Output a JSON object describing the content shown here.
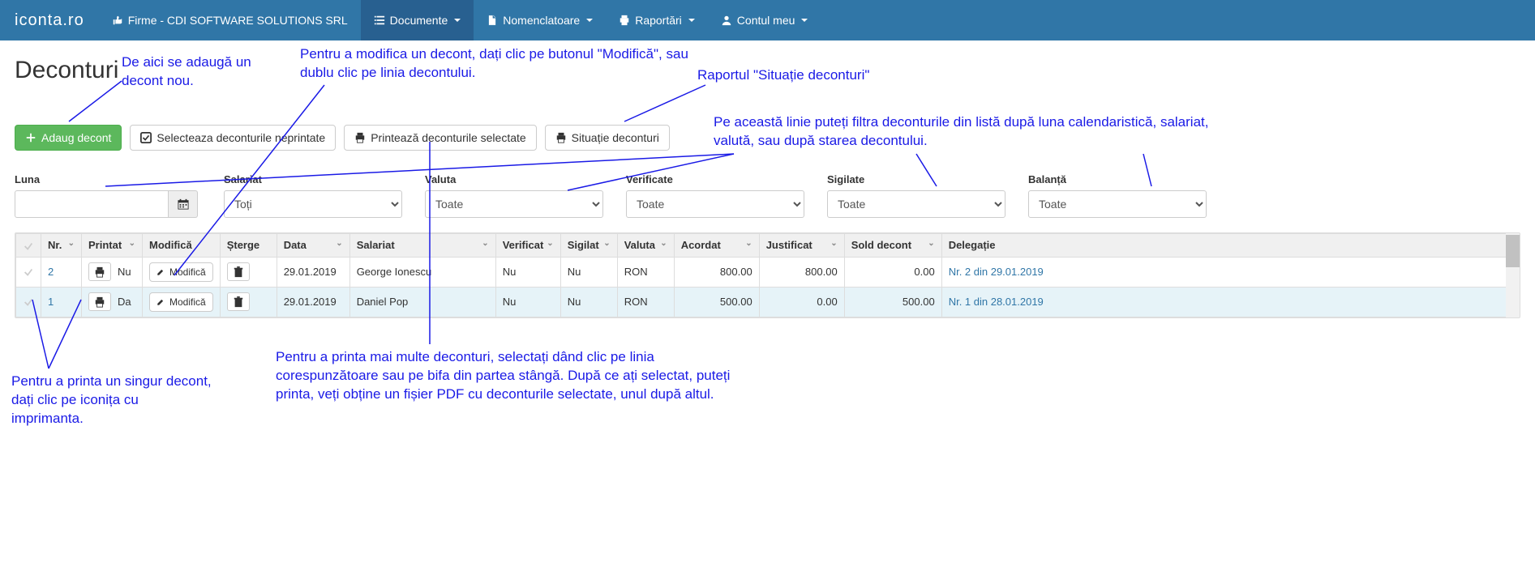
{
  "brand": "iconta.ro",
  "nav": {
    "firme": "Firme - CDI SOFTWARE SOLUTIONS SRL",
    "documente": "Documente",
    "nomenclatoare": "Nomenclatoare",
    "raportari": "Raportări",
    "contul": "Contul meu"
  },
  "page_title": "Deconturi",
  "toolbar": {
    "adaug": "Adaug decont",
    "selecteaza": "Selecteaza deconturile neprintate",
    "printeaza": "Printează deconturile selectate",
    "situatie": "Situație deconturi"
  },
  "filters": {
    "luna_label": "Luna",
    "salariat_label": "Salariat",
    "salariat_value": "Toți",
    "valuta_label": "Valuta",
    "valuta_value": "Toate",
    "verificate_label": "Verificate",
    "verificate_value": "Toate",
    "sigilate_label": "Sigilate",
    "sigilate_value": "Toate",
    "balanta_label": "Balanță",
    "balanta_value": "Toate"
  },
  "columns": {
    "nr": "Nr.",
    "printat": "Printat",
    "modifica": "Modifică",
    "sterge": "Șterge",
    "data": "Data",
    "salariat": "Salariat",
    "verificat": "Verificat",
    "sigilat": "Sigilat",
    "valuta": "Valuta",
    "acordat": "Acordat",
    "justificat": "Justificat",
    "sold": "Sold decont",
    "delegatie": "Delegație"
  },
  "rows": [
    {
      "nr": "2",
      "printat": "Nu",
      "modifica": "Modifică",
      "data": "29.01.2019",
      "salariat": "George Ionescu",
      "verificat": "Nu",
      "sigilat": "Nu",
      "valuta": "RON",
      "acordat": "800.00",
      "justificat": "800.00",
      "sold": "0.00",
      "delegatie": "Nr. 2 din 29.01.2019"
    },
    {
      "nr": "1",
      "printat": "Da",
      "modifica": "Modifică",
      "data": "29.01.2019",
      "salariat": "Daniel Pop",
      "verificat": "Nu",
      "sigilat": "Nu",
      "valuta": "RON",
      "acordat": "500.00",
      "justificat": "0.00",
      "sold": "500.00",
      "delegatie": "Nr. 1 din 28.01.2019"
    }
  ],
  "annotations": {
    "a1": "De aici se adaugă un decont nou.",
    "a2": "Pentru a modifica un decont, dați clic pe butonul \"Modifică\", sau dublu clic pe linia decontului.",
    "a3": "Raportul \"Situație deconturi\"",
    "a4": "Pe această linie puteți filtra deconturile din listă după luna calendaristică, salariat, valută, sau după starea decontului.",
    "a5": "Pentru a printa un singur decont, dați clic pe iconița cu imprimanta.",
    "a6": "Pentru a printa mai multe deconturi, selectați dând clic pe linia corespunzătoare sau pe bifa din partea stângă. După ce ați selectat, puteți printa, veți obține un fișier PDF cu deconturile selectate, unul după altul."
  }
}
